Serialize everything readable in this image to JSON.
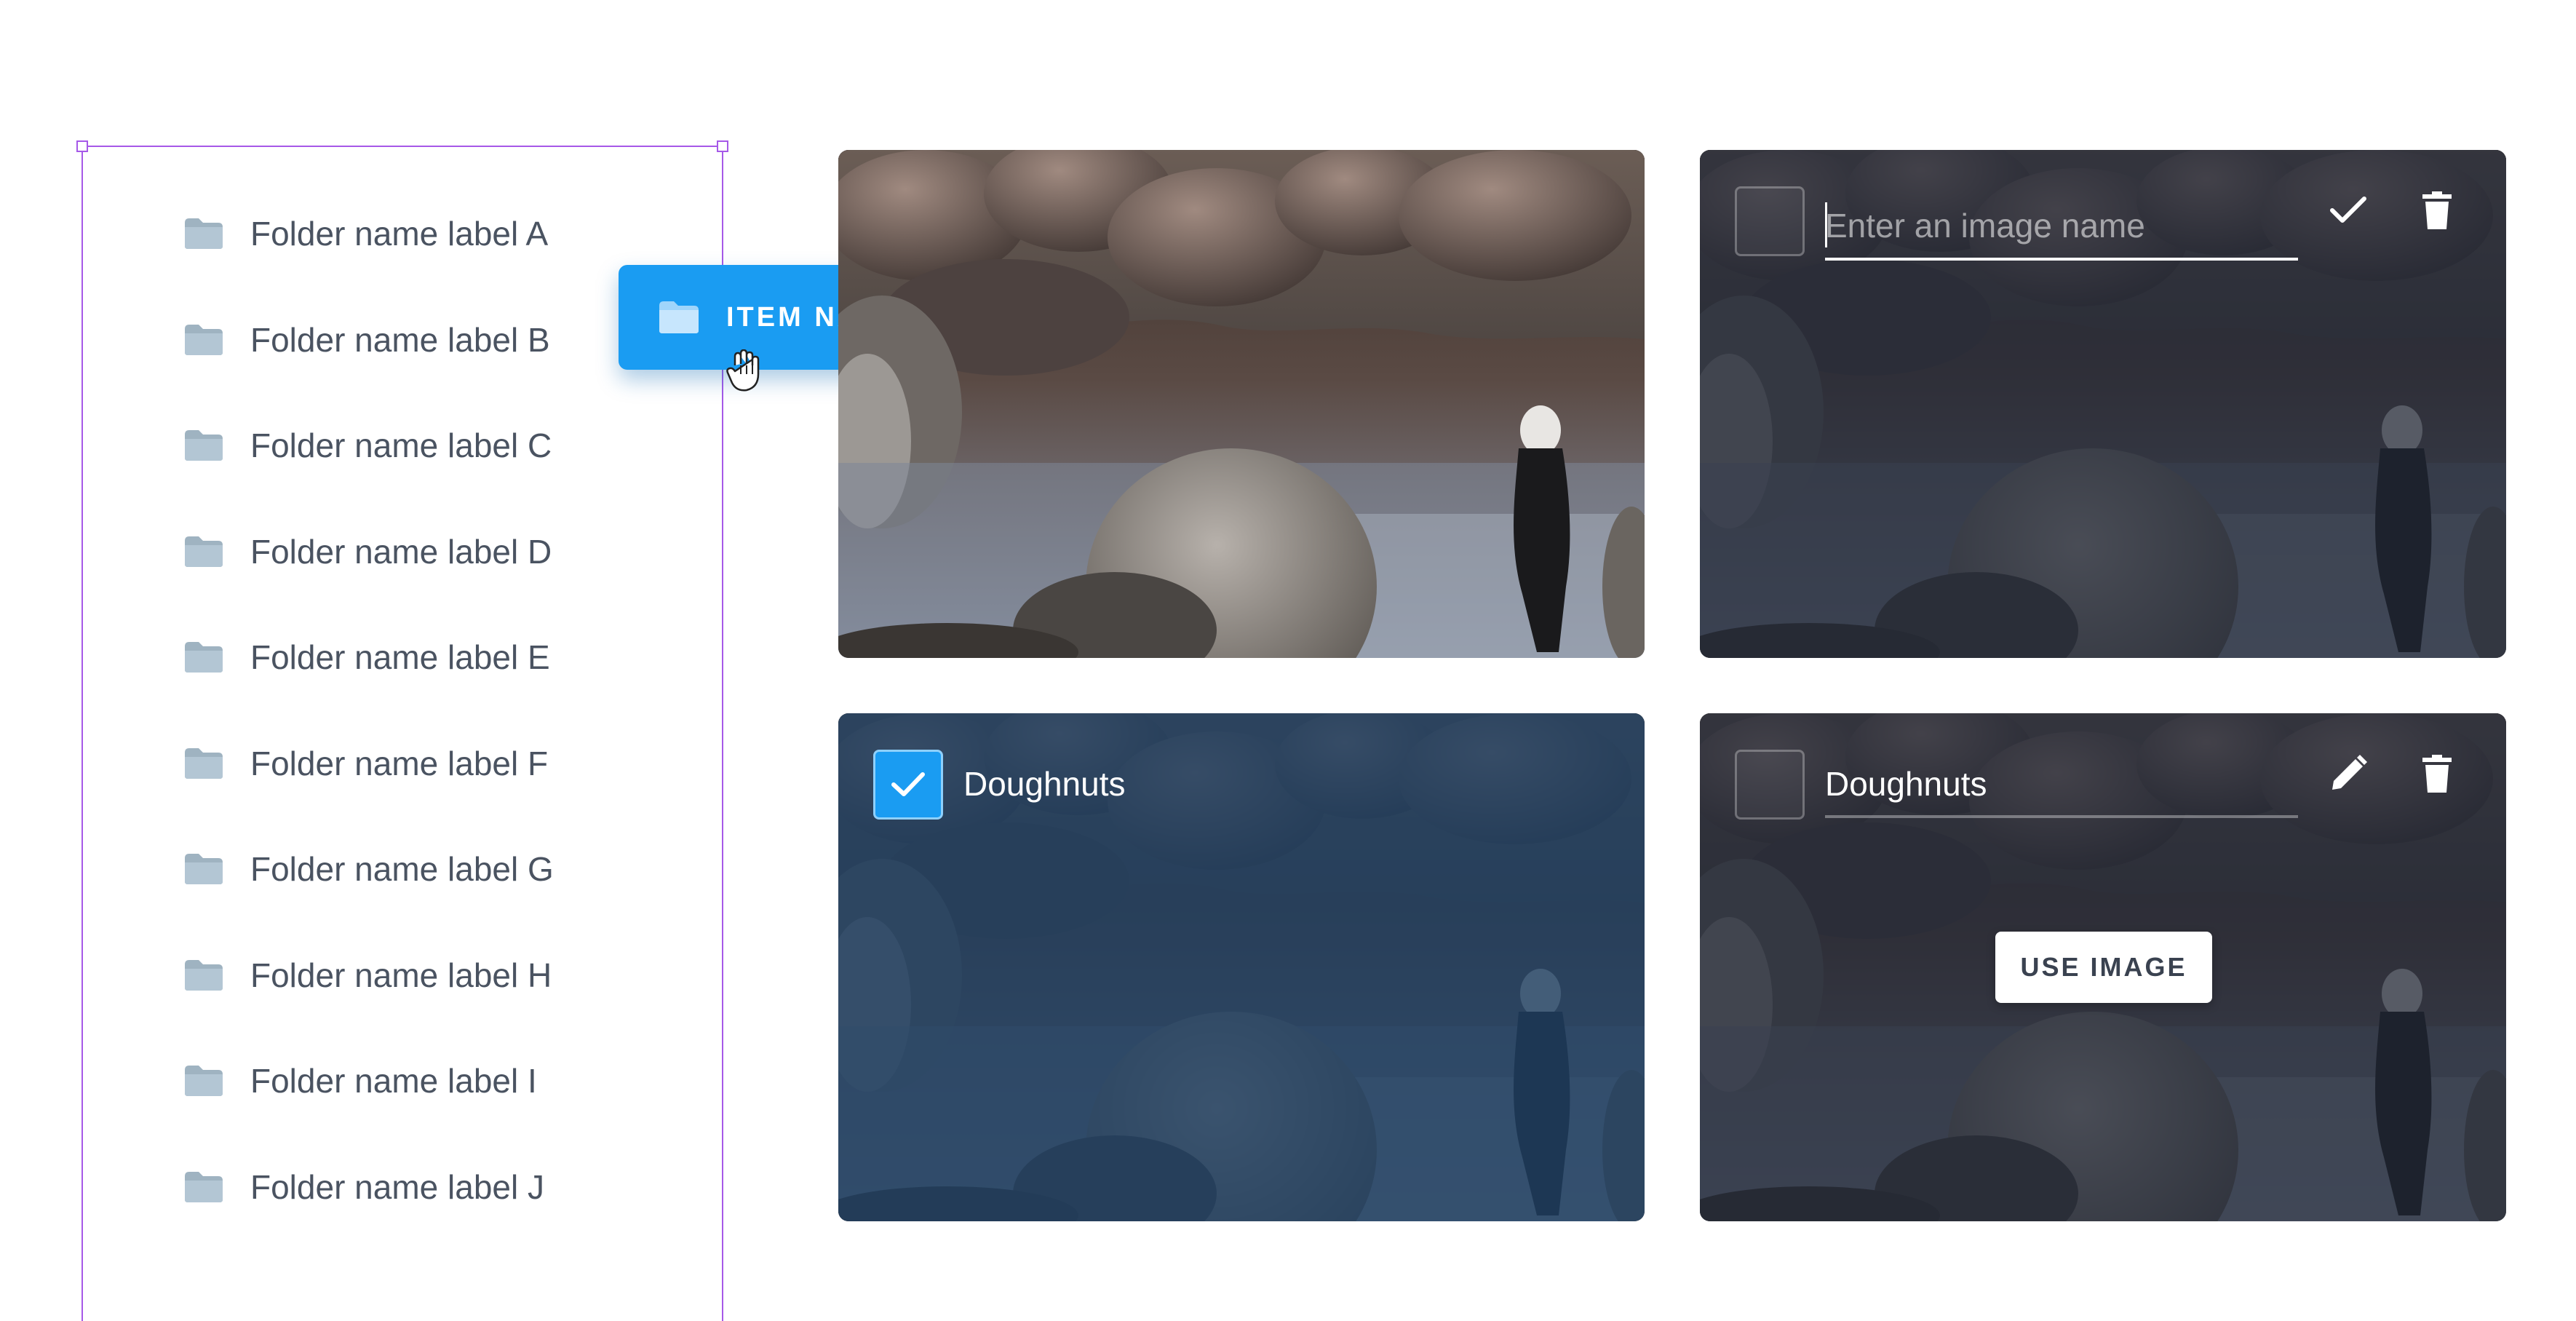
{
  "folders": {
    "items": [
      {
        "label": "Folder name label A"
      },
      {
        "label": "Folder name label B"
      },
      {
        "label": "Folder name label C"
      },
      {
        "label": "Folder name label D"
      },
      {
        "label": "Folder name label E"
      },
      {
        "label": "Folder name label F"
      },
      {
        "label": "Folder name label G"
      },
      {
        "label": "Folder name label H"
      },
      {
        "label": "Folder name label I"
      },
      {
        "label": "Folder name label J"
      }
    ],
    "icon": "folder-icon",
    "icon_color": "#b3c6d4",
    "selection_color": "#a659e8"
  },
  "drag_chip": {
    "label": "ITEM NAME",
    "icon": "folder-icon",
    "cursor_icon": "grab-hand-icon",
    "color": "#1a9cf2"
  },
  "cards": {
    "rename_card": {
      "input_placeholder": "Enter an image name",
      "input_value": "",
      "confirm_icon": "check-icon",
      "delete_icon": "trash-icon",
      "checked": false
    },
    "selected_card": {
      "name": "Doughnuts",
      "checked": true,
      "check_icon": "check-icon",
      "accent_color": "#1a9cf2"
    },
    "hover_card": {
      "name": "Doughnuts",
      "checked": false,
      "edit_icon": "pencil-icon",
      "delete_icon": "trash-icon",
      "use_button_label": "USE IMAGE"
    }
  }
}
